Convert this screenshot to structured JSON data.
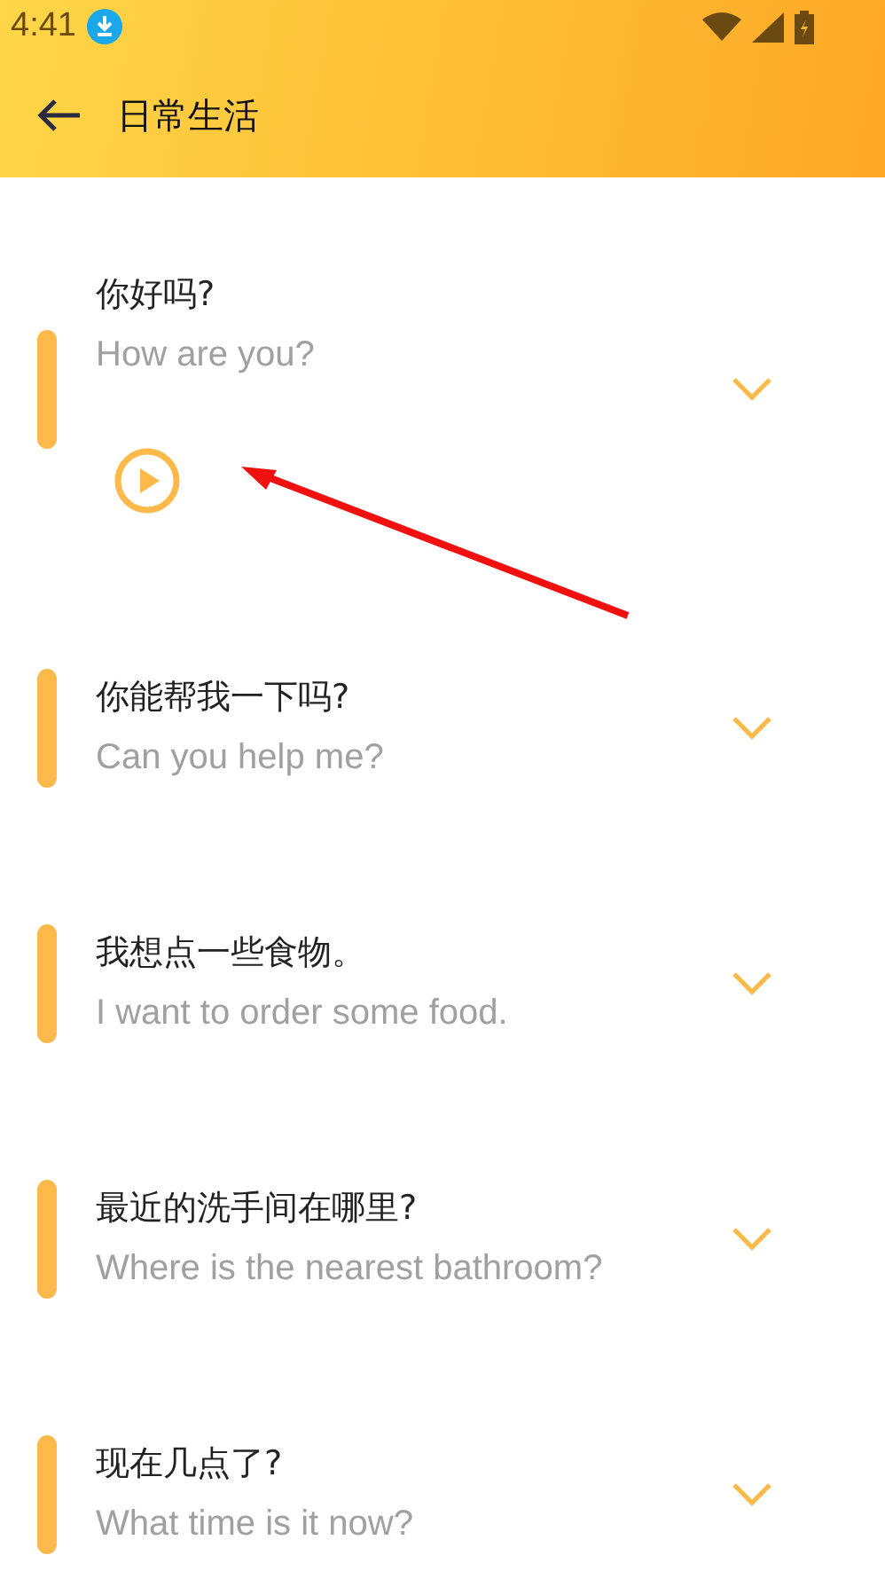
{
  "status_bar": {
    "time": "4:41"
  },
  "toolbar": {
    "title": "日常生活"
  },
  "phrases": [
    {
      "chinese": "你好吗?",
      "english": "How are you?",
      "expanded": true
    },
    {
      "chinese": "你能帮我一下吗?",
      "english": "Can you help me?",
      "expanded": false
    },
    {
      "chinese": "我想点一些食物。",
      "english": "I want to order some food.",
      "expanded": false
    },
    {
      "chinese": "最近的洗手间在哪里?",
      "english": "Where is the nearest bathroom?",
      "expanded": false
    },
    {
      "chinese": "现在几点了?",
      "english": "What time is it now?",
      "expanded": false
    }
  ]
}
